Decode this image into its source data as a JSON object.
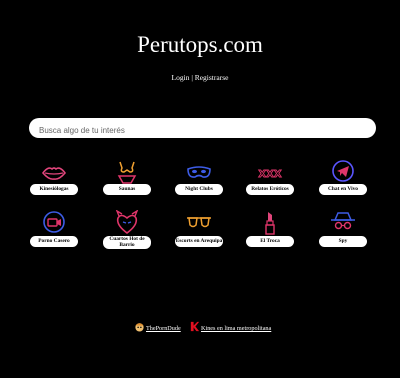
{
  "site": {
    "title": "Perutops.com"
  },
  "auth": {
    "login": "Login",
    "separator": "|",
    "register": "Registrarse"
  },
  "search": {
    "placeholder": "Busca algo de tu interés"
  },
  "categories": [
    {
      "label": "Kinesiólogas",
      "icon": "lips-icon",
      "color": "#e0457b"
    },
    {
      "label": "Saunas",
      "icon": "bikini-icon",
      "color": "#f0a030"
    },
    {
      "label": "Night Clubs",
      "icon": "mask-icon",
      "color": "#3d5ce6"
    },
    {
      "label": "Relatos Eróticos",
      "icon": "xxx-icon",
      "color": "#e0356a"
    },
    {
      "label": "Chat en Vivo",
      "icon": "telegram-icon",
      "color": "#5a55ff"
    },
    {
      "label": "Porno Casero",
      "icon": "camera-icon",
      "color": "#3d5ce6"
    },
    {
      "label": "Cuartos Hot de Barrio",
      "icon": "devil-heart-icon",
      "color": "#e0356a"
    },
    {
      "label": "Escorts en Arequipa",
      "icon": "sunglasses-icon",
      "color": "#f0a030"
    },
    {
      "label": "El Troca",
      "icon": "lipstick-icon",
      "color": "#e0457b"
    },
    {
      "label": "Spy",
      "icon": "spy-icon",
      "color": "#3d5ce6"
    }
  ],
  "footer": {
    "link1": "ThePornDude",
    "link2": "Kines en lima metropolitana"
  }
}
